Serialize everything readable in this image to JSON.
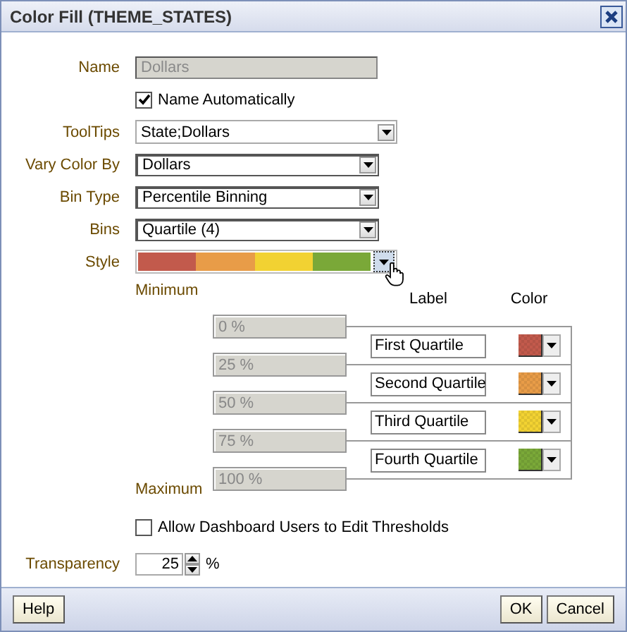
{
  "window": {
    "title": "Color Fill (THEME_STATES)"
  },
  "fields": [
    {
      "kind": "text",
      "label": "Name",
      "value": "Dollars",
      "disabled": true
    },
    {
      "kind": "checkbox",
      "label": "Name Automatically",
      "checked": true
    },
    {
      "kind": "combo",
      "label": "ToolTips",
      "value": "State;Dollars"
    },
    {
      "kind": "select",
      "label": "Vary Color By",
      "value": "Dollars"
    },
    {
      "kind": "select",
      "label": "Bin Type",
      "value": "Percentile Binning"
    },
    {
      "kind": "select",
      "label": "Bins",
      "value": "Quartile (4)"
    },
    {
      "kind": "palette",
      "label": "Style"
    }
  ],
  "thresholds": {
    "minimum_label": "Minimum",
    "maximum_label": "Maximum",
    "label_header": "Label",
    "color_header": "Color",
    "values": [
      {
        "value": "0 %",
        "disabled": true
      },
      {
        "value": "25 %",
        "disabled": true
      },
      {
        "value": "50 %",
        "disabled": true
      },
      {
        "value": "75 %",
        "disabled": true
      },
      {
        "value": "100 %",
        "disabled": true
      }
    ],
    "bins": [
      {
        "label": "First Quartile",
        "color": "#c25a4c"
      },
      {
        "label": "Second Quartile",
        "color": "#e89c48"
      },
      {
        "label": "Third Quartile",
        "color": "#f2d232"
      },
      {
        "label": "Fourth Quartile",
        "color": "#7aa838"
      }
    ]
  },
  "allow_edit": {
    "label": "Allow Dashboard Users to Edit Thresholds",
    "checked": false
  },
  "transparency": {
    "label": "Transparency",
    "value": "25",
    "unit": "%"
  },
  "buttons_left": [
    "Help"
  ],
  "buttons_right": [
    "OK",
    "Cancel"
  ]
}
